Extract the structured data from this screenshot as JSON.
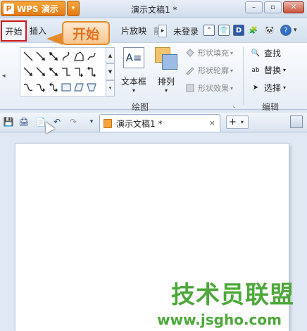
{
  "titlebar": {
    "app_name": "WPS 演示",
    "app_logo": "P",
    "document_title": "演示文稿1 *",
    "minimize": "–",
    "maximize": "▫",
    "close": "✕"
  },
  "tabs": {
    "start": "开始",
    "insert": "插入",
    "slideshow": "片放映",
    "login": "未登录"
  },
  "callout": {
    "text": "开始"
  },
  "ribbon": {
    "draw_group_label": "绘图",
    "text_box": "文本框",
    "arrange": "排列",
    "shape_fill": "形状填充",
    "shape_outline": "形状轮廓",
    "shape_effect": "形状效果",
    "find": "查找",
    "replace": "替换",
    "select": "选择",
    "edit_group_label": "编辑",
    "textbox_glyph": "A≡"
  },
  "docbar": {
    "doc_tab": "演示文稿1 *",
    "close_tab": "×",
    "new_tab": "+"
  },
  "watermark": {
    "text": "技术员联盟",
    "url": "www.jsgho.com"
  },
  "colors": {
    "accent_orange": "#e37a12",
    "highlight_red": "#d21818",
    "watermark_green": "#4da83a"
  }
}
